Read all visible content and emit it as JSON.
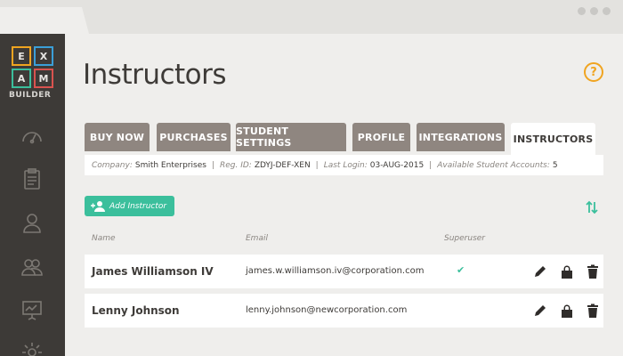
{
  "logo": {
    "letters": [
      "E",
      "X",
      "A",
      "M"
    ],
    "colors": [
      "#f0a420",
      "#3b9fd8",
      "#3bbf9c",
      "#d9534f"
    ],
    "word": "BUILDER"
  },
  "sidebar": {
    "icons": [
      "dashboard-icon",
      "clipboard-icon",
      "user-icon",
      "users-icon",
      "presentation-icon",
      "settings-icon"
    ]
  },
  "page": {
    "title": "Instructors",
    "help_label": "?"
  },
  "tabs": [
    {
      "label": "BUY NOW",
      "active": false
    },
    {
      "label": "PURCHASES",
      "active": false
    },
    {
      "label": "STUDENT SETTINGS",
      "active": false
    },
    {
      "label": "PROFILE",
      "active": false
    },
    {
      "label": "INTEGRATIONS",
      "active": false
    },
    {
      "label": "INSTRUCTORS",
      "active": true
    }
  ],
  "info": {
    "company_label": "Company:",
    "company": "Smith Enterprises",
    "reg_label": "Reg. ID:",
    "reg": "ZDYJ-DEF-XEN",
    "login_label": "Last Login:",
    "login": "03-AUG-2015",
    "accounts_label": "Available Student Accounts:",
    "accounts": "5",
    "separator": "|"
  },
  "actions": {
    "add_label": "Add Instructor"
  },
  "table": {
    "headers": {
      "name": "Name",
      "email": "Email",
      "superuser": "Superuser"
    },
    "rows": [
      {
        "name": "James Williamson IV",
        "email": "james.w.williamson.iv@corporation.com",
        "superuser": "✔"
      },
      {
        "name": "Lenny Johnson",
        "email": "lenny.johnson@newcorporation.com",
        "superuser": ""
      }
    ]
  },
  "colors": {
    "accent": "#3bbf9c",
    "tab": "#8f8680",
    "sidebar": "#3d3a37",
    "help": "#f0a420"
  }
}
